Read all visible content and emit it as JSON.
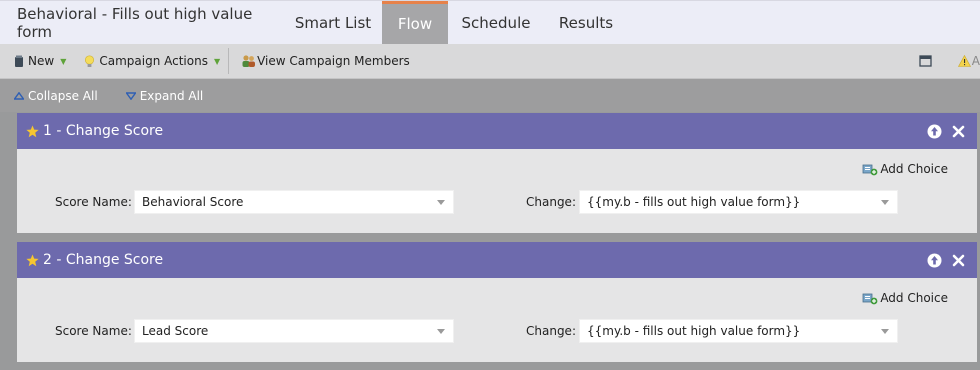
{
  "tabs": {
    "campaign_title": "Behavioral - Fills out high value form",
    "items": [
      {
        "label": "Smart List"
      },
      {
        "label": "Flow",
        "active": true
      },
      {
        "label": "Schedule"
      },
      {
        "label": "Results"
      }
    ]
  },
  "toolbar": {
    "new_label": "New",
    "campaign_actions_label": "Campaign Actions",
    "view_members_label": "View Campaign Members",
    "truncated_right_label": "A"
  },
  "subbar": {
    "collapse_label": "Collapse All",
    "expand_label": "Expand All"
  },
  "steps": [
    {
      "title": "1 - Change Score",
      "add_choice_label": "Add Choice",
      "score_name_label": "Score Name:",
      "score_name_value": "Behavioral Score",
      "change_label": "Change:",
      "change_value": "{{my.b - fills out high value form}}"
    },
    {
      "title": "2 - Change Score",
      "add_choice_label": "Add Choice",
      "score_name_label": "Score Name:",
      "score_name_value": "Lead Score",
      "change_label": "Change:",
      "change_value": "{{my.b - fills out high value form}}"
    }
  ],
  "colors": {
    "step_header": "#6d6aad",
    "active_tab": "#a6a6a8",
    "active_tab_accent": "#e7824a",
    "menu_caret": "#5fa33a"
  }
}
